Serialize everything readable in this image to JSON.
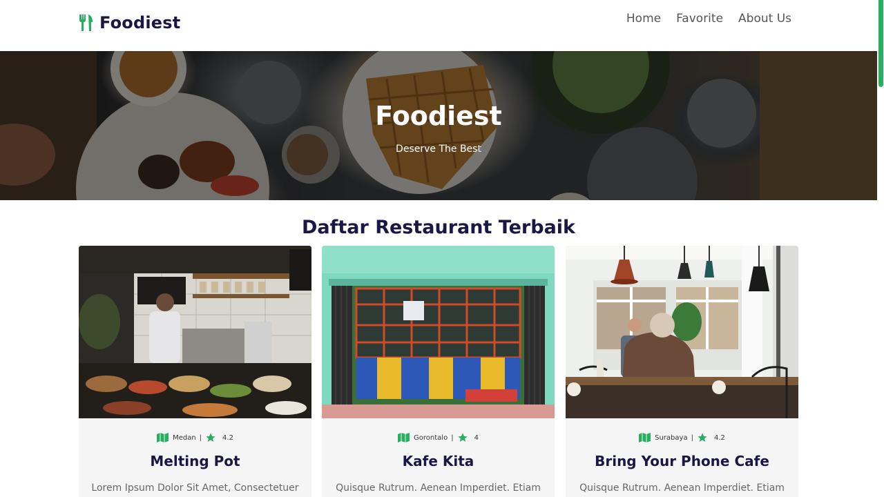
{
  "brand": {
    "name": "Foodiest"
  },
  "nav": {
    "items": [
      {
        "label": "Home"
      },
      {
        "label": "Favorite"
      },
      {
        "label": "About Us"
      }
    ]
  },
  "hero": {
    "title": "Foodiest",
    "subtitle": "Deserve The Best"
  },
  "section": {
    "title": "Daftar Restaurant Terbaik"
  },
  "restaurants": [
    {
      "city": "Medan",
      "separator": "|",
      "rating": "4.2",
      "name": "Melting Pot",
      "description": "Lorem Ipsum Dolor Sit Amet, Consectetuer"
    },
    {
      "city": "Gorontalo",
      "separator": "|",
      "rating": "4",
      "name": "Kafe Kita",
      "description": "Quisque Rutrum. Aenean Imperdiet. Etiam"
    },
    {
      "city": "Surabaya",
      "separator": "|",
      "rating": "4.2",
      "name": "Bring Your Phone Cafe",
      "description": "Quisque Rutrum. Aenean Imperdiet. Etiam"
    }
  ],
  "colors": {
    "accent": "#27ae60",
    "heading": "#1b1744",
    "text": "#666666",
    "card_bg": "#f5f5f5"
  },
  "icons": {
    "brand": "utensils-icon",
    "city": "map-icon",
    "rating": "star-icon"
  }
}
